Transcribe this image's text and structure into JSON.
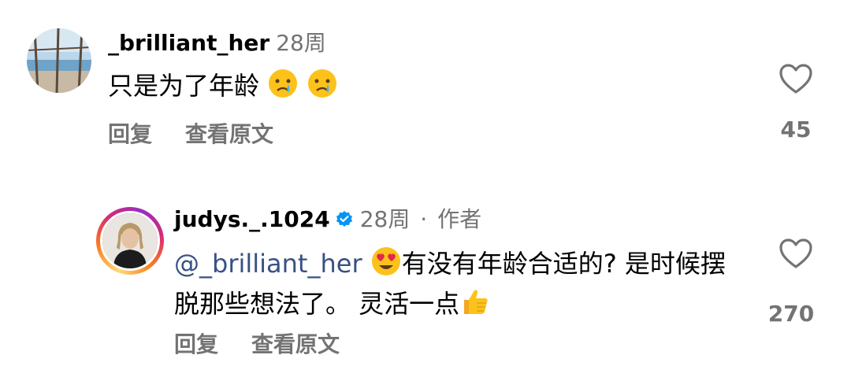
{
  "comments": [
    {
      "username": "_brilliant_her",
      "time": "28周",
      "text": "只是为了年龄",
      "actions": {
        "reply": "回复",
        "see_translation": "查看原文"
      },
      "likes": "45"
    },
    {
      "username": "judys._.1024",
      "time": "28周",
      "separator": "·",
      "author_label": "作者",
      "mention": "@_brilliant_her",
      "text_part1": "有没有年龄合适的? 是时候摆脱那些想法了。 灵活一点",
      "actions": {
        "reply": "回复",
        "see_translation": "查看原文"
      },
      "likes": "270"
    }
  ],
  "icons": {
    "like": "heart-outline-icon",
    "verified": "verified-badge-icon",
    "crying": "crying-face-emoji",
    "heart_eyes": "heart-eyes-emoji",
    "thumbs_up": "thumbs-up-emoji"
  },
  "colors": {
    "mention": "#385185",
    "meta": "#737373",
    "verified": "#0095f6"
  }
}
